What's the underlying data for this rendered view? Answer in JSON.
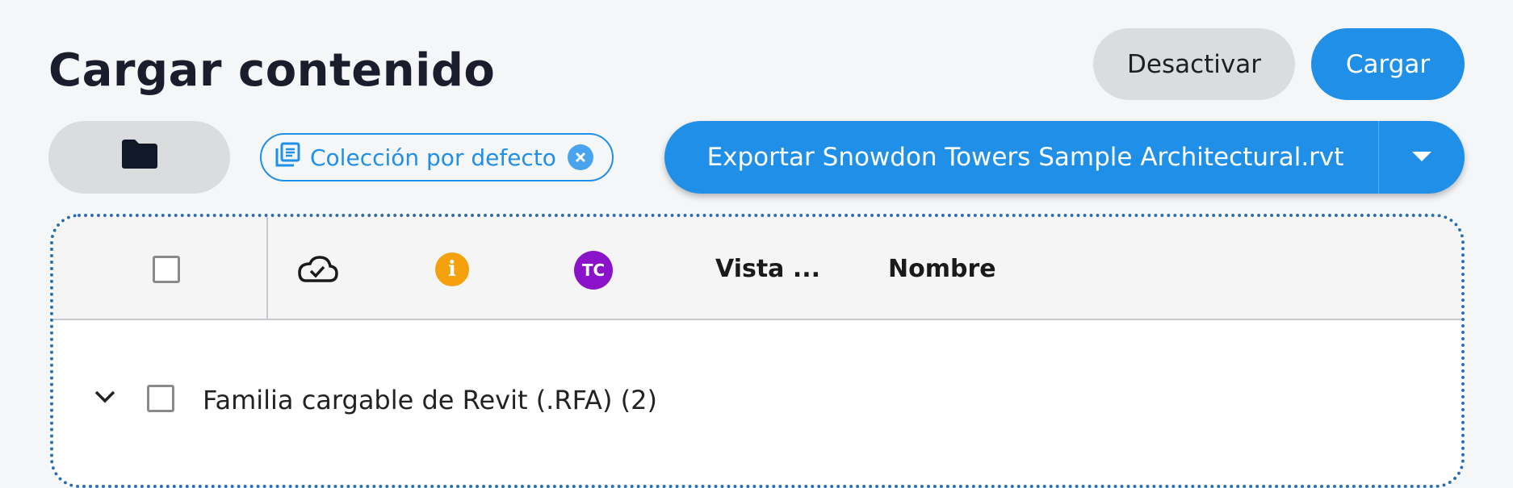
{
  "header": {
    "title": "Cargar contenido",
    "deactivate_label": "Desactivar",
    "upload_label": "Cargar"
  },
  "toolbar": {
    "folder_icon": "folder-icon",
    "collection_chip": {
      "label": "Colección por defecto",
      "icon": "collection-icon"
    },
    "export_button": {
      "label": "Exportar Snowdon Towers Sample Architectural.rvt",
      "dropdown_icon": "caret-down-icon"
    }
  },
  "table": {
    "columns": [
      {
        "icon": "cloud-check-icon"
      },
      {
        "icon": "info-icon",
        "text": "i"
      },
      {
        "icon": "tc-badge",
        "text": "TC"
      },
      {
        "label": "Vista ..."
      },
      {
        "label": "Nombre"
      }
    ],
    "groups": [
      {
        "label": "Familia cargable de Revit (.RFA)",
        "count": "(2)",
        "expanded": true
      }
    ]
  },
  "colors": {
    "accent": "#1f8fe8",
    "info": "#f5a10b",
    "tc": "#8a13c9",
    "dropzone_border": "#2a6fb5"
  }
}
